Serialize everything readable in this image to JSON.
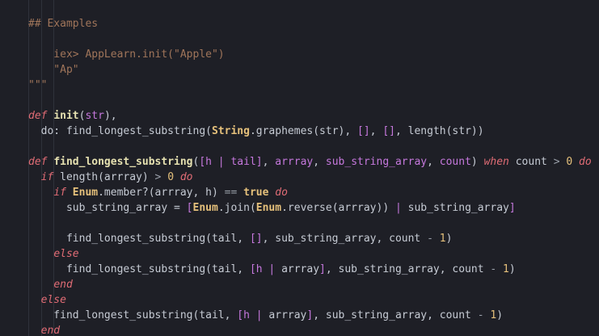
{
  "lines": [
    [
      {
        "t": "## Examples",
        "c": "doc"
      }
    ],
    [],
    [
      {
        "t": "    iex> AppLearn.init(\"Apple\")",
        "c": "doc"
      }
    ],
    [
      {
        "t": "    \"Ap\"",
        "c": "doc"
      }
    ],
    [
      {
        "t": "\"\"\"",
        "c": "doc"
      }
    ],
    [],
    [
      {
        "t": "def",
        "c": "kw"
      },
      {
        "t": " "
      },
      {
        "t": "init",
        "c": "fn"
      },
      {
        "t": "("
      },
      {
        "t": "str",
        "c": "param"
      },
      {
        "t": "),"
      }
    ],
    [
      {
        "t": "  do: find_longest_substring("
      },
      {
        "t": "String",
        "c": "mod"
      },
      {
        "t": ".graphemes(str), "
      },
      {
        "t": "[]",
        "c": "param"
      },
      {
        "t": ", "
      },
      {
        "t": "[]",
        "c": "param"
      },
      {
        "t": ", length(str))"
      }
    ],
    [],
    [
      {
        "t": "def",
        "c": "kw"
      },
      {
        "t": " "
      },
      {
        "t": "find_longest_substring",
        "c": "fn"
      },
      {
        "t": "("
      },
      {
        "t": "[h | tail]",
        "c": "param"
      },
      {
        "t": ", "
      },
      {
        "t": "arrray",
        "c": "param"
      },
      {
        "t": ", "
      },
      {
        "t": "sub_string_array",
        "c": "param"
      },
      {
        "t": ", "
      },
      {
        "t": "count",
        "c": "param"
      },
      {
        "t": ") "
      },
      {
        "t": "when",
        "c": "kw"
      },
      {
        "t": " count "
      },
      {
        "t": ">",
        "c": "op"
      },
      {
        "t": " "
      },
      {
        "t": "0",
        "c": "num"
      },
      {
        "t": " "
      },
      {
        "t": "do",
        "c": "kw"
      }
    ],
    [
      {
        "t": "  "
      },
      {
        "t": "if",
        "c": "kw"
      },
      {
        "t": " length(arrray) "
      },
      {
        "t": ">",
        "c": "op"
      },
      {
        "t": " "
      },
      {
        "t": "0",
        "c": "num"
      },
      {
        "t": " "
      },
      {
        "t": "do",
        "c": "kw"
      }
    ],
    [
      {
        "t": "    "
      },
      {
        "t": "if",
        "c": "kw"
      },
      {
        "t": " "
      },
      {
        "t": "Enum",
        "c": "mod"
      },
      {
        "t": ".member?(arrray, h) "
      },
      {
        "t": "==",
        "c": "op"
      },
      {
        "t": " "
      },
      {
        "t": "true",
        "c": "bool"
      },
      {
        "t": " "
      },
      {
        "t": "do",
        "c": "kw"
      }
    ],
    [
      {
        "t": "      sub_string_array = "
      },
      {
        "t": "[",
        "c": "param"
      },
      {
        "t": "Enum",
        "c": "mod"
      },
      {
        "t": ".join("
      },
      {
        "t": "Enum",
        "c": "mod"
      },
      {
        "t": ".reverse(arrray)) "
      },
      {
        "t": "|",
        "c": "param"
      },
      {
        "t": " sub_string_array"
      },
      {
        "t": "]",
        "c": "param"
      }
    ],
    [],
    [
      {
        "t": "      find_longest_substring(tail, "
      },
      {
        "t": "[]",
        "c": "param"
      },
      {
        "t": ", sub_string_array, count "
      },
      {
        "t": "-",
        "c": "op"
      },
      {
        "t": " "
      },
      {
        "t": "1",
        "c": "num"
      },
      {
        "t": ")"
      }
    ],
    [
      {
        "t": "    "
      },
      {
        "t": "else",
        "c": "kw"
      }
    ],
    [
      {
        "t": "      find_longest_substring(tail, "
      },
      {
        "t": "[h | ",
        "c": "param"
      },
      {
        "t": "arrray"
      },
      {
        "t": "]",
        "c": "param"
      },
      {
        "t": ", sub_string_array, count "
      },
      {
        "t": "-",
        "c": "op"
      },
      {
        "t": " "
      },
      {
        "t": "1",
        "c": "num"
      },
      {
        "t": ")"
      }
    ],
    [
      {
        "t": "    "
      },
      {
        "t": "end",
        "c": "kw"
      }
    ],
    [
      {
        "t": "  "
      },
      {
        "t": "else",
        "c": "kw"
      }
    ],
    [
      {
        "t": "    find_longest_substring(tail, "
      },
      {
        "t": "[h | ",
        "c": "param"
      },
      {
        "t": "arrray"
      },
      {
        "t": "]",
        "c": "param"
      },
      {
        "t": ", sub_string_array, count "
      },
      {
        "t": "-",
        "c": "op"
      },
      {
        "t": " "
      },
      {
        "t": "1",
        "c": "num"
      },
      {
        "t": ")"
      }
    ],
    [
      {
        "t": "  "
      },
      {
        "t": "end",
        "c": "kw"
      }
    ]
  ]
}
